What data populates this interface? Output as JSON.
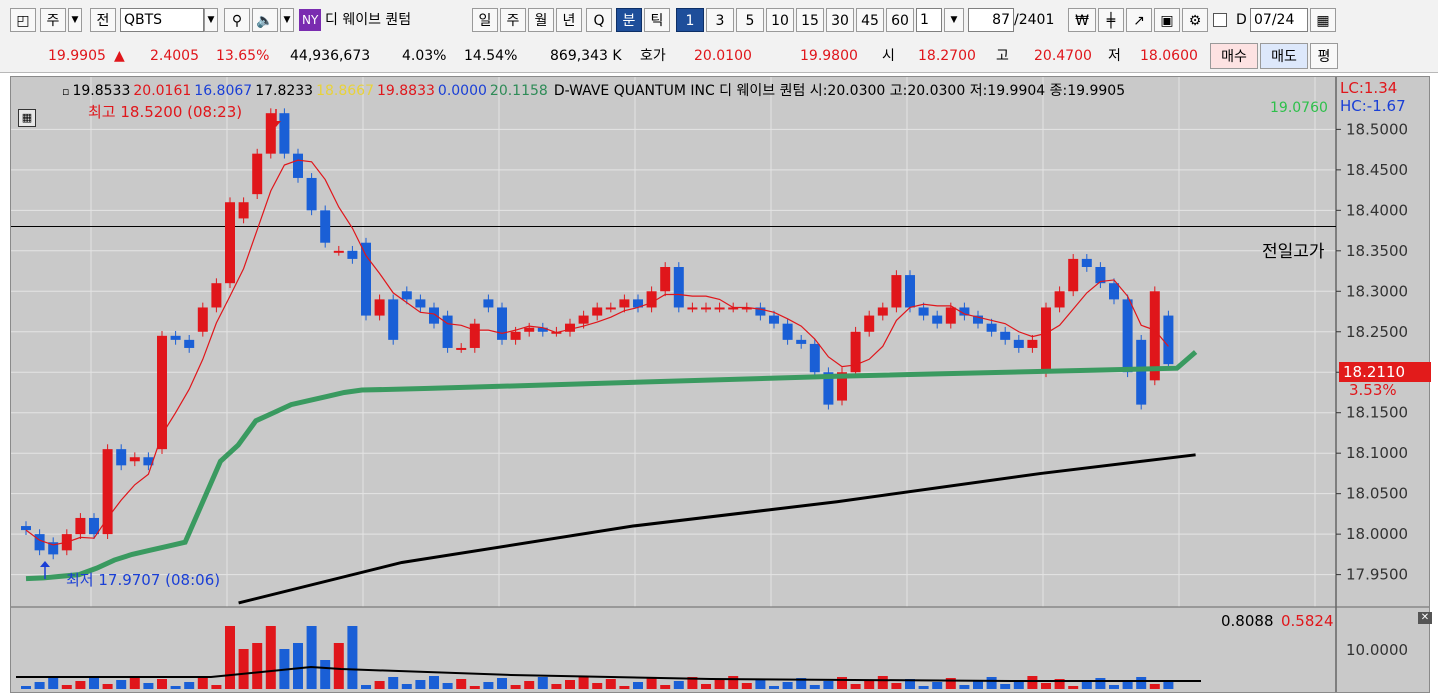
{
  "toolbar": {
    "market_type": "주",
    "mode": "전",
    "symbol": "QBTS",
    "exchange_badge": "NY",
    "stock_name": "디 웨이브 퀀텀",
    "period_buttons": [
      "일",
      "주",
      "월",
      "년",
      "Q",
      "분",
      "틱"
    ],
    "selected_period": "분",
    "interval_buttons": [
      "1",
      "3",
      "5",
      "10",
      "15",
      "30",
      "45",
      "60"
    ],
    "selected_interval": "1",
    "interval_value": "1",
    "count_value": "87",
    "count_total": "/2401",
    "date_value": "07/24",
    "date_checkbox_label": "D"
  },
  "quote": {
    "price": "19.9905",
    "change_arrow": "▲",
    "change": "2.4005",
    "change_pct": "13.65%",
    "volume": "44,936,673",
    "vol_pct1": "4.03%",
    "vol_pct2": "14.54%",
    "amount": "869,343 K",
    "bid_ask_label": "호가",
    "ask": "20.0100",
    "bid": "19.9800",
    "open_label": "시",
    "open": "18.2700",
    "high_label": "고",
    "high": "20.4700",
    "low_label": "저",
    "low": "18.0600",
    "buy_label": "매수",
    "sell_label": "매도",
    "flat_label": "평"
  },
  "legend": {
    "values": [
      {
        "text": "19.8533",
        "color": "#000000"
      },
      {
        "text": "20.0161",
        "color": "#e0161b"
      },
      {
        "text": "16.8067",
        "color": "#1a3fd6"
      },
      {
        "text": "17.8233",
        "color": "#000000"
      },
      {
        "text": "18.8667",
        "color": "#e8d23a"
      },
      {
        "text": "19.8833",
        "color": "#e0161b"
      },
      {
        "text": "0.0000",
        "color": "#1a3fd6"
      },
      {
        "text": "20.1158",
        "color": "#2e8b57"
      }
    ],
    "title": "D-WAVE QUANTUM INC  디 웨이브 퀀텀 시:20.0300 고:20.0300 저:19.9904 종:19.9905",
    "lc": "LC:1.34",
    "hc": "HC:-1.67",
    "green_value": "19.0760"
  },
  "annotations": {
    "high_marker": "최고 18.5200 (08:23)",
    "low_marker": "최저 17.9707 (08:06)",
    "prev_high_label": "전일고가",
    "current_price_tag": "18.2110",
    "current_pct": "3.53%",
    "volume_legend_1": "0.8088",
    "volume_legend_2": "0.5824"
  },
  "colors": {
    "up": "#e0161b",
    "down": "#1a5fd6",
    "ma_short": "#e0161b",
    "ma_green": "#3a9a60",
    "ma_long": "#000000",
    "background": "#c9c9c9"
  },
  "chart_data": {
    "type": "candlestick",
    "y_ticks": [
      "18.5000",
      "18.4500",
      "18.4000",
      "18.3500",
      "18.3000",
      "18.2500",
      "18.2000",
      "18.1500",
      "18.1000",
      "18.0500",
      "18.0000",
      "17.9500"
    ],
    "ylim": [
      17.91,
      18.54
    ],
    "prev_high_line": 18.38,
    "candles": [
      [
        18.01,
        18.005
      ],
      [
        18.0,
        17.98
      ],
      [
        17.99,
        17.975
      ],
      [
        17.98,
        18.0
      ],
      [
        18.0,
        18.02
      ],
      [
        18.02,
        18.0
      ],
      [
        18.0,
        18.105
      ],
      [
        18.105,
        18.085
      ],
      [
        18.09,
        18.095
      ],
      [
        18.095,
        18.085
      ],
      [
        18.105,
        18.245
      ],
      [
        18.245,
        18.24
      ],
      [
        18.24,
        18.23
      ],
      [
        18.25,
        18.28
      ],
      [
        18.28,
        18.31
      ],
      [
        18.31,
        18.41
      ],
      [
        18.39,
        18.41
      ],
      [
        18.42,
        18.47
      ],
      [
        18.47,
        18.52
      ],
      [
        18.52,
        18.47
      ],
      [
        18.47,
        18.44
      ],
      [
        18.44,
        18.4
      ],
      [
        18.4,
        18.36
      ],
      [
        18.35,
        18.35
      ],
      [
        18.35,
        18.34
      ],
      [
        18.36,
        18.27
      ],
      [
        18.27,
        18.29
      ],
      [
        18.29,
        18.24
      ],
      [
        18.3,
        18.29
      ],
      [
        18.29,
        18.28
      ],
      [
        18.28,
        18.26
      ],
      [
        18.27,
        18.23
      ],
      [
        18.23,
        18.23
      ],
      [
        18.23,
        18.26
      ],
      [
        18.29,
        18.28
      ],
      [
        18.28,
        18.24
      ],
      [
        18.24,
        18.25
      ],
      [
        18.25,
        18.255
      ],
      [
        18.255,
        18.25
      ],
      [
        18.25,
        18.25
      ],
      [
        18.25,
        18.26
      ],
      [
        18.26,
        18.27
      ],
      [
        18.27,
        18.28
      ],
      [
        18.28,
        18.28
      ],
      [
        18.28,
        18.29
      ],
      [
        18.29,
        18.28
      ],
      [
        18.28,
        18.3
      ],
      [
        18.3,
        18.33
      ],
      [
        18.33,
        18.28
      ],
      [
        18.28,
        18.28
      ],
      [
        18.28,
        18.28
      ],
      [
        18.28,
        18.28
      ],
      [
        18.28,
        18.28
      ],
      [
        18.28,
        18.28
      ],
      [
        18.28,
        18.27
      ],
      [
        18.27,
        18.26
      ],
      [
        18.26,
        18.24
      ],
      [
        18.24,
        18.235
      ],
      [
        18.235,
        18.2
      ],
      [
        18.2,
        18.16
      ],
      [
        18.165,
        18.2
      ],
      [
        18.2,
        18.25
      ],
      [
        18.25,
        18.27
      ],
      [
        18.27,
        18.28
      ],
      [
        18.28,
        18.32
      ],
      [
        18.32,
        18.28
      ],
      [
        18.28,
        18.27
      ],
      [
        18.27,
        18.26
      ],
      [
        18.26,
        18.28
      ],
      [
        18.28,
        18.27
      ],
      [
        18.27,
        18.26
      ],
      [
        18.26,
        18.25
      ],
      [
        18.25,
        18.24
      ],
      [
        18.24,
        18.23
      ],
      [
        18.23,
        18.24
      ],
      [
        18.2,
        18.28
      ],
      [
        18.28,
        18.3
      ],
      [
        18.3,
        18.34
      ],
      [
        18.34,
        18.33
      ],
      [
        18.33,
        18.31
      ],
      [
        18.31,
        18.29
      ],
      [
        18.29,
        18.2
      ],
      [
        18.24,
        18.16
      ],
      [
        18.19,
        18.3
      ],
      [
        18.27,
        18.21
      ]
    ],
    "volume_ticks": [
      "10.0000"
    ]
  }
}
